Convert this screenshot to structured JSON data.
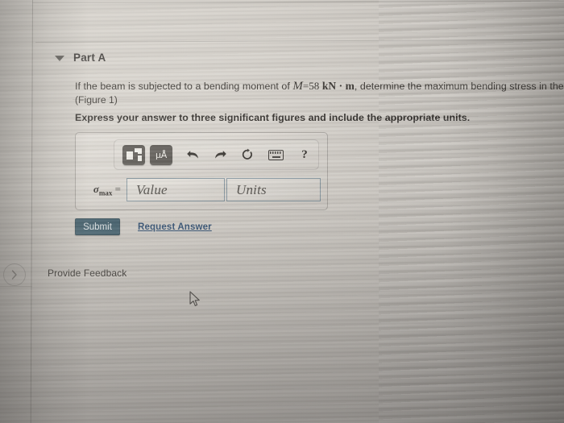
{
  "part": {
    "toggle_icon": "caret-down-icon",
    "title": "Part A"
  },
  "question": {
    "text_before_var": "If the beam is subjected to a bending moment of ",
    "variable": "M",
    "equals": "=",
    "value": "58",
    "units": "kN · m",
    "text_after": ", determine the maximum bending stress in the beam.",
    "figure_ref": "(Figure 1)",
    "instruction": "Express your answer to three significant figures and include the appropriate units."
  },
  "toolbar": {
    "template_button_label": "math-template",
    "units_button_label": "μÅ",
    "undo_label": "undo",
    "redo_label": "redo",
    "reset_label": "reset",
    "keyboard_label": "keyboard",
    "help_label": "?"
  },
  "answer": {
    "symbol": "σ",
    "subscript": "max",
    "equals": "=",
    "value_placeholder": "Value",
    "units_placeholder": "Units",
    "value": "",
    "units": ""
  },
  "actions": {
    "submit_label": "Submit",
    "request_answer_label": "Request Answer"
  },
  "footer": {
    "provide_feedback_label": "Provide Feedback"
  },
  "panel": {
    "expand_icon": "chevron-right-icon"
  },
  "colors": {
    "submit_background": "#2e4f5f",
    "link": "#1d3f66",
    "field_border": "#7b8e99",
    "toolbar_button": "#4e4b47",
    "page_background": "#cdc9c3"
  }
}
